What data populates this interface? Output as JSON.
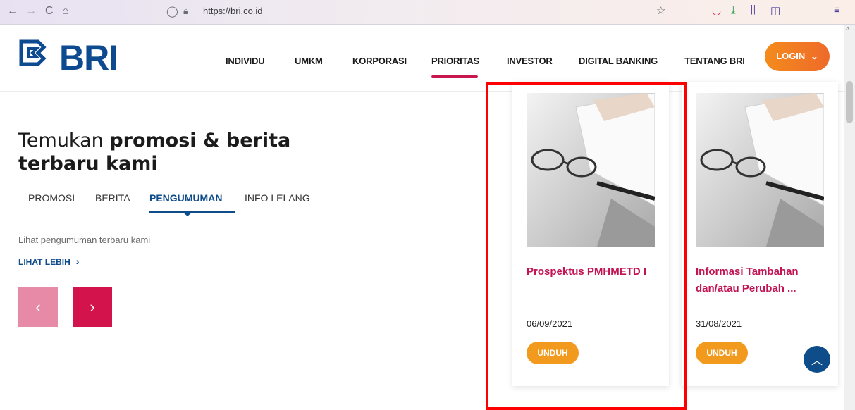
{
  "browser": {
    "url": "https://bri.co.id",
    "icons": [
      "back-icon",
      "forward-icon",
      "reload-icon",
      "home-icon",
      "shield-icon",
      "lock-icon",
      "star-icon",
      "pocket-icon",
      "download-icon",
      "library-icon",
      "sidebar-icon",
      "menu-icon"
    ]
  },
  "header": {
    "logo_text": "BRI",
    "menu": [
      "INDIVIDU",
      "UMKM",
      "KORPORASI",
      "PRIORITAS",
      "INVESTOR",
      "DIGITAL BANKING",
      "TENTANG BRI"
    ],
    "active_menu": "PRIORITAS",
    "login_label": "LOGIN"
  },
  "content": {
    "heading_normal": "Temukan ",
    "heading_bold": "promosi & berita terbaru kami",
    "tabs": [
      "PROMOSI",
      "BERITA",
      "PENGUMUMAN",
      "INFO LELANG"
    ],
    "active_tab": "PENGUMUMAN",
    "subtext": "Lihat pengumuman terbaru kami",
    "more_label": "LIHAT LEBIH",
    "prev_arrow": "‹",
    "next_arrow": "›"
  },
  "cards": [
    {
      "title": "Prospektus PMHMETD I",
      "date": "06/09/2021",
      "button": "UNDUH"
    },
    {
      "title": "Informasi Tambahan dan/atau Perubah ...",
      "date": "31/08/2021",
      "button": "UNDUH"
    }
  ],
  "colors": {
    "brand_blue": "#0e4a8f",
    "brand_red": "#c8164f",
    "orange": "#f29a1d",
    "highlight": "#ff0000"
  }
}
